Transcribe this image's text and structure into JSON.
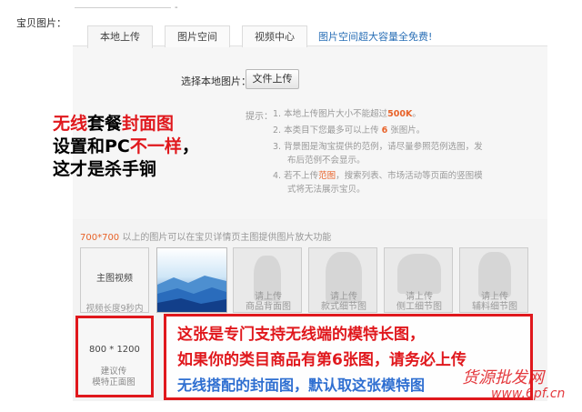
{
  "field_label": "宝贝图片：",
  "top_dash": "-",
  "tabs": [
    {
      "label": "本地上传",
      "active": true
    },
    {
      "label": "图片空间",
      "active": false
    },
    {
      "label": "视频中心",
      "active": false
    }
  ],
  "tab_link": "图片空间超大容量全免费!",
  "select_label": "选择本地图片：",
  "upload_button": "文件上传",
  "tips_label": "提示：",
  "tips": [
    {
      "num": "1.",
      "pre": "本地上传图片大小不能超过",
      "hl": "500K",
      "post": "。"
    },
    {
      "num": "2.",
      "pre": "本类目下您最多可以上传 ",
      "hl": "6",
      "post": " 张图片。"
    },
    {
      "num": "3.",
      "line1": "背景图是淘宝提供的范例，请尽量参照范例选图，发",
      "line2": "布后范例不会显示。"
    },
    {
      "num": "4.",
      "pre": "若不上传",
      "hl": "范图",
      "line1_post": "，搜索列表、市场活动等页面的竖图模",
      "line2": "式将无法展示宝贝。"
    }
  ],
  "promo": {
    "line1": [
      {
        "text": "无线",
        "red": true
      },
      {
        "text": "套餐",
        "red": false
      },
      {
        "text": "封面图",
        "red": true
      }
    ],
    "line2": [
      {
        "text": "设置和PC",
        "red": false
      },
      {
        "text": "不一样",
        "red": true
      },
      {
        "text": "，",
        "red": false
      }
    ],
    "line3": [
      {
        "text": "这才是杀手锏",
        "red": false
      }
    ]
  },
  "hint": {
    "hl": "700*700",
    "rest": " 以上的图片可以在宝贝详情页主图提供图片放大功能"
  },
  "video_slot": {
    "title": "主图视频",
    "sub": "视频长度9秒内"
  },
  "photo_slots": [
    {
      "label1": "请上传",
      "label2": "商品背面图"
    },
    {
      "label1": "请上传",
      "label2": "款式细节图"
    },
    {
      "label1": "请上传",
      "label2": "侧工细节图"
    },
    {
      "label1": "请上传",
      "label2": "辅料细节图"
    }
  ],
  "tall_slot": {
    "size": "800 * 1200",
    "note1": "建议传",
    "note2": "模特正面图"
  },
  "callout": {
    "line1": "这张是专门支持无线端的模特长图，",
    "line2": "如果你的类目商品有第6张图，请务必上传",
    "line3": "无线搭配的封面图，默认取这张模特图"
  },
  "watermark": {
    "line1": "货源批发网",
    "line2": "www.6pf.cn"
  },
  "colors": {
    "accent_red": "#e0181d",
    "link_blue": "#2a6fb6",
    "orange": "#e8632a"
  }
}
